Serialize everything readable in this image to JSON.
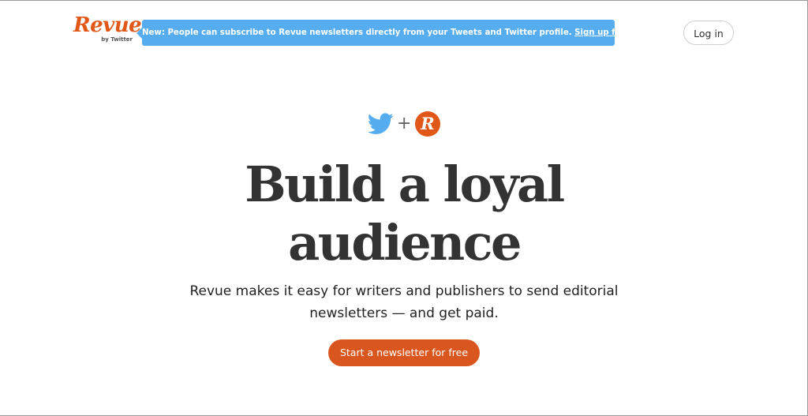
{
  "header": {
    "logo_text": "Revue",
    "logo_subtext": "by Twitter",
    "announcement": {
      "prefix": "New: People can subscribe to Revue newsletters directly from your Tweets and Twitter profile. ",
      "link_text": "Sign up for free",
      "suffix": "."
    },
    "login_label": "Log in"
  },
  "hero": {
    "plus": "+",
    "revue_icon_letter": "R",
    "headline": "Build a loyal audience",
    "subhead": "Revue makes it easy for writers and publishers to send editorial newsletters — and get paid.",
    "cta_label": "Start a newsletter for free"
  },
  "colors": {
    "brand_orange": "#e15718",
    "twitter_blue": "#55acee",
    "text_dark": "#333333"
  },
  "icons": {
    "twitter": "twitter-bird-icon",
    "revue": "revue-r-icon"
  }
}
